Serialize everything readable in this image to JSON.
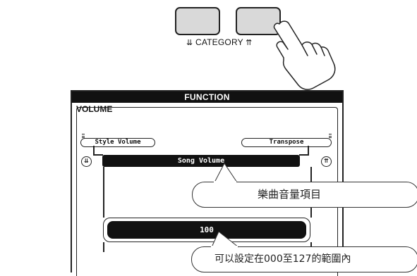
{
  "category": {
    "label": "CATEGORY",
    "down_icon": "double-arrow-down-icon",
    "up_icon": "double-arrow-up-icon"
  },
  "lcd": {
    "header": "FUNCTION",
    "title": "VOLUME",
    "left_item": "Style Volume",
    "right_item": "Transpose",
    "current_item": "Song Volume",
    "value": "100"
  },
  "callouts": {
    "item_note": "樂曲音量項目",
    "range_note": "可以設定在000至127的範圍內"
  }
}
